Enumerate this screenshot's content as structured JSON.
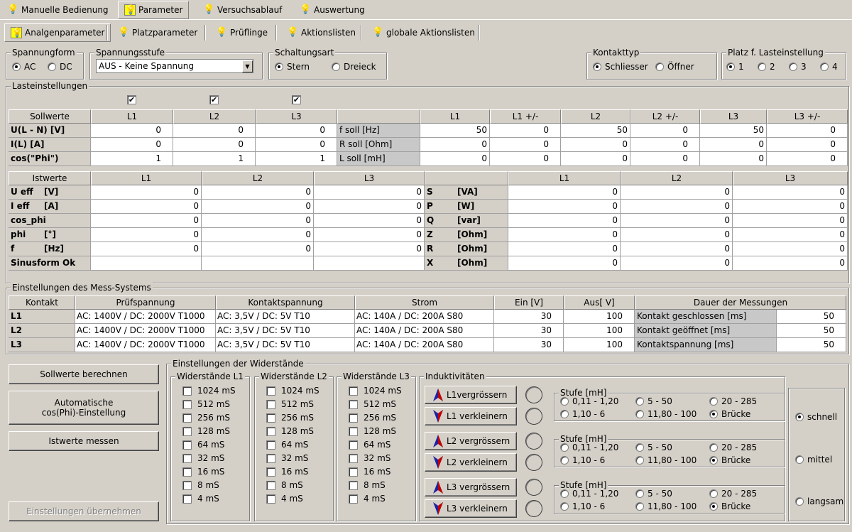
{
  "main_tabs": [
    "Manuelle Bedienung",
    "Parameter",
    "Versuchsablauf",
    "Auswertung"
  ],
  "sub_tabs": [
    "Analgenparameter",
    "Platzparameter",
    "Prüflinge",
    "Aktionslisten",
    "globale Aktionslisten"
  ],
  "spannungsform": {
    "title": "Spannungform",
    "opt1": "AC",
    "opt2": "DC"
  },
  "spannungsstufe": {
    "title": "Spannungsstufe",
    "value": "AUS - Keine Spannung"
  },
  "schaltungsart": {
    "title": "Schaltungsart",
    "opt1": "Stern",
    "opt2": "Dreieck"
  },
  "kontakttyp": {
    "title": "Kontakttyp",
    "opt1": "Schliesser",
    "opt2": "Öffner"
  },
  "platz": {
    "title": "Platz f. Lasteinstellung",
    "opts": [
      "1",
      "2",
      "3",
      "4"
    ]
  },
  "last": {
    "title": "Lasteinstellungen",
    "soll_headers": [
      "Sollwerte",
      "L1",
      "L2",
      "L3",
      "",
      "L1",
      "L1 +/-",
      "L2",
      "L2 +/-",
      "L3",
      "L3 +/-"
    ],
    "soll_rows": [
      {
        "label": "U(L - N) [V]",
        "v": [
          "0",
          "0",
          "0"
        ],
        "label2": "f soll  [Hz]",
        "w": [
          "50",
          "0",
          "50",
          "0",
          "50",
          "0"
        ]
      },
      {
        "label": "I(L) [A]",
        "v": [
          "0",
          "0",
          "0"
        ],
        "label2": "R soll [Ohm]",
        "w": [
          "0",
          "0",
          "0",
          "0",
          "0",
          "0"
        ]
      },
      {
        "label": "cos(\"Phi\")",
        "v": [
          "1",
          "1",
          "1"
        ],
        "label2": "L soll  [mH]",
        "w": [
          "0",
          "0",
          "0",
          "0",
          "0",
          "0"
        ]
      }
    ],
    "ist_headers": [
      "Istwerte",
      "L1",
      "L2",
      "L3",
      "",
      "L1",
      "L2",
      "L3"
    ],
    "ist_rows": [
      {
        "label": "U eff",
        "unit": "[V]",
        "v": [
          "0",
          "0",
          "0"
        ],
        "label2": "S",
        "unit2": "[VA]",
        "w": [
          "0",
          "0",
          "0"
        ]
      },
      {
        "label": "I eff",
        "unit": "[A]",
        "v": [
          "0",
          "0",
          "0"
        ],
        "label2": "P",
        "unit2": "[W]",
        "w": [
          "0",
          "0",
          "0"
        ]
      },
      {
        "label": "cos_phi",
        "unit": "",
        "v": [
          "0",
          "0",
          "0"
        ],
        "label2": "Q",
        "unit2": "[var]",
        "w": [
          "0",
          "0",
          "0"
        ]
      },
      {
        "label": "phi",
        "unit": "[°]",
        "v": [
          "0",
          "0",
          "0"
        ],
        "label2": "Z",
        "unit2": "[Ohm]",
        "w": [
          "0",
          "0",
          "0"
        ]
      },
      {
        "label": "f",
        "unit": "[Hz]",
        "v": [
          "0",
          "0",
          "0"
        ],
        "label2": "R",
        "unit2": "[Ohm]",
        "w": [
          "0",
          "0",
          "0"
        ]
      },
      {
        "label": "Sinusform Ok",
        "unit": "",
        "v": [
          "",
          "",
          ""
        ],
        "label2": "X",
        "unit2": "[Ohm]",
        "w": [
          "0",
          "0",
          "0"
        ]
      }
    ]
  },
  "mess": {
    "title": "Einstellungen des Mess-Systems",
    "headers": [
      "Kontakt",
      "Prüfspannung",
      "Kontaktspannung",
      "Strom",
      "Ein [V]",
      "Aus[ V]",
      "Dauer der Messungen"
    ],
    "rows": [
      {
        "k": "L1",
        "p": "AC: 1400V / DC: 2000V T1000",
        "ks": "AC: 3,5V  / DC:  5V T10",
        "s": "AC: 140A / DC: 200A S80",
        "ein": "30",
        "aus": "100",
        "d": "Kontakt geschlossen [ms]",
        "dv": "50"
      },
      {
        "k": "L2",
        "p": "AC: 1400V / DC: 2000V T1000",
        "ks": "AC: 3,5V  / DC:  5V T10",
        "s": "AC: 140A / DC: 200A S80",
        "ein": "30",
        "aus": "100",
        "d": "Kontakt geöffnet [ms]",
        "dv": "50"
      },
      {
        "k": "L3",
        "p": "AC: 1400V / DC: 2000V T1000",
        "ks": "AC: 3,5V  / DC:  5V T10",
        "s": "AC: 140A / DC: 200A S80",
        "ein": "30",
        "aus": "100",
        "d": "Kontaktspannung [ms]",
        "dv": "50"
      }
    ]
  },
  "buttons": {
    "sollwerte": "Sollwerte berechnen",
    "auto": "Automatische cos(Phi)-Einstellung",
    "ist": "Istwerte messen",
    "uebern": "Einstellungen übernehmen"
  },
  "widerstaende": {
    "title": "Einstellungen der Widerstände",
    "groups": [
      "Widerstände L1",
      "Widerstände L2",
      "Widerstände L3"
    ],
    "values": [
      "1024 mS",
      "512 mS",
      "256 mS",
      "128 mS",
      "64 mS",
      "32 mS",
      "16 mS",
      "8 mS",
      "4 mS"
    ]
  },
  "induktiv": {
    "title": "Induktivitäten",
    "buttons": [
      "L1vergrössern",
      "L1 verkleinern",
      "L2 vergrössern",
      "L2 verkleinern",
      "L3 vergrössern",
      "L3 verkleinern"
    ],
    "stufe_title": "Stufe [mH]",
    "stufe_opts": [
      "0,11 - 1,20",
      "5 - 50",
      "20 - 285",
      "1,10 - 6",
      "11,80 - 100",
      "Brücke"
    ]
  },
  "speed": [
    "schnell",
    "mittel",
    "langsam"
  ]
}
